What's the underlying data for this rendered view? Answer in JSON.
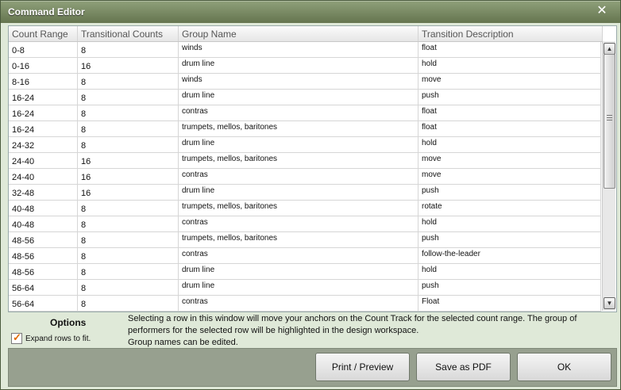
{
  "window": {
    "title": "Command Editor",
    "close_glyph": "✕"
  },
  "table": {
    "columns": [
      "Count Range",
      "Transitional Counts",
      "Group Name",
      "Transition Description"
    ],
    "rows": [
      [
        "0-8",
        "8",
        "winds",
        "float"
      ],
      [
        "0-16",
        "16",
        "drum line",
        "hold"
      ],
      [
        "8-16",
        "8",
        "winds",
        "move"
      ],
      [
        "16-24",
        "8",
        "drum line",
        "push"
      ],
      [
        "16-24",
        "8",
        "contras",
        "float"
      ],
      [
        "16-24",
        "8",
        "trumpets, mellos, baritones",
        "float"
      ],
      [
        "24-32",
        "8",
        "drum line",
        "hold"
      ],
      [
        "24-40",
        "16",
        "trumpets, mellos, baritones",
        "move"
      ],
      [
        "24-40",
        "16",
        "contras",
        "move"
      ],
      [
        "32-48",
        "16",
        "drum line",
        "push"
      ],
      [
        "40-48",
        "8",
        "trumpets, mellos, baritones",
        "rotate"
      ],
      [
        "40-48",
        "8",
        "contras",
        "hold"
      ],
      [
        "48-56",
        "8",
        "trumpets, mellos, baritones",
        "push"
      ],
      [
        "48-56",
        "8",
        "contras",
        "follow-the-leader"
      ],
      [
        "48-56",
        "8",
        "drum line",
        "hold"
      ],
      [
        "56-64",
        "8",
        "drum line",
        "push"
      ],
      [
        "56-64",
        "8",
        "contras",
        "Float"
      ]
    ]
  },
  "scrollbar": {
    "up_glyph": "▲",
    "down_glyph": "▼"
  },
  "options": {
    "title": "Options",
    "expand_rows_label": "Expand rows to fit.",
    "expand_rows_checked": true,
    "check_glyph": "✓"
  },
  "info": {
    "line1": "Selecting a row in this window will move your anchors on the Count Track for the selected count range. The group of",
    "line2": "performers for the selected row will be highlighted in the design workspace.",
    "line3": "Group names can be edited."
  },
  "buttons": {
    "print": "Print / Preview",
    "pdf": "Save as PDF",
    "ok": "OK"
  },
  "colors": {
    "titlebar": "#7a8b65",
    "accent_check": "#e06a00",
    "footer": "#97a08f"
  }
}
